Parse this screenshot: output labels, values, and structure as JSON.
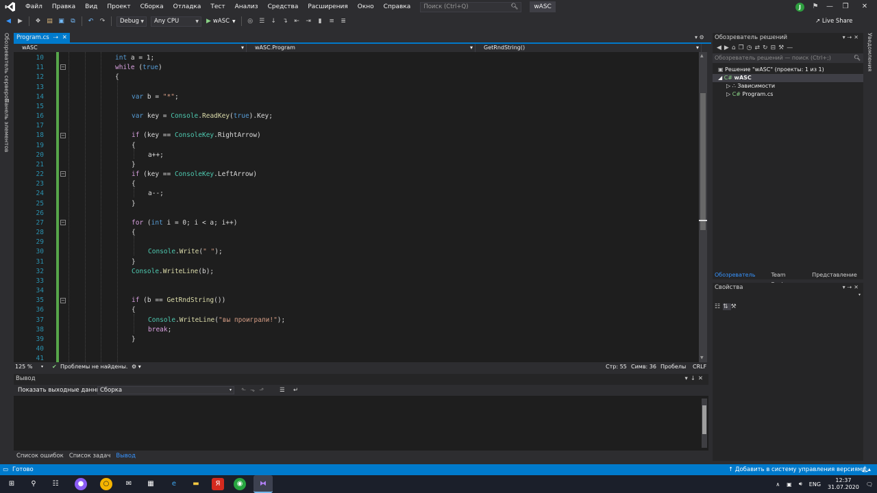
{
  "menu": {
    "items": [
      "Файл",
      "Правка",
      "Вид",
      "Проект",
      "Сборка",
      "Отладка",
      "Тест",
      "Анализ",
      "Средства",
      "Расширения",
      "Окно",
      "Справка"
    ],
    "search_placeholder": "Поиск (Ctrl+Q)",
    "project_badge": "wASC",
    "avatar_letter": "J"
  },
  "toolbar": {
    "config": "Debug",
    "platform": "Any CPU",
    "run_label": "wASC",
    "live_share": "Live Share"
  },
  "left_strip": {
    "server_explorer": "Обозреватель серверов",
    "toolbox": "Панель элементов"
  },
  "right_strip": {
    "notifications": "Уведомления"
  },
  "editor": {
    "tab_label": "Program.cs",
    "nav_project": "wASC",
    "nav_class": "wASC.Program",
    "nav_member": "GetRndString()",
    "line_numbers": [
      "10",
      "11",
      "12",
      "13",
      "14",
      "15",
      "16",
      "17",
      "18",
      "19",
      "20",
      "21",
      "22",
      "23",
      "24",
      "25",
      "26",
      "27",
      "28",
      "29",
      "30",
      "31",
      "32",
      "33",
      "34",
      "35",
      "36",
      "37",
      "38",
      "39",
      "40",
      "41"
    ],
    "code": {
      "l10": "int a = 1;",
      "l11": "while (true)",
      "l12": "{",
      "l14": "var b = \"*\";",
      "l16": "var key = Console.ReadKey(true).Key;",
      "l18": "if (key == ConsoleKey.RightArrow)",
      "l19": "{",
      "l20": "a++;",
      "l21": "}",
      "l22": "if (key == ConsoleKey.LeftArrow)",
      "l23": "{",
      "l24": "a--;",
      "l25": "}",
      "l27": "for (int i = 0; i < a; i++)",
      "l28": "{",
      "l30": "Console.Write(\" \");",
      "l31": "}",
      "l32": "Console.WriteLine(b);",
      "l35": "if (b == GetRndString())",
      "l36": "{",
      "l37": "Console.WriteLine(\"вы проиграли!\");",
      "l38": "break;",
      "l39": "}"
    },
    "zoom": "125 %",
    "problems": "Проблемы не найдены.",
    "line_pos": "Стр: 55",
    "col_pos": "Симв: 36",
    "whitespace": "Пробелы",
    "line_ending": "CRLF"
  },
  "output": {
    "title": "Вывод",
    "show_from_label": "Показать выходные данные из:",
    "source": "Сборка"
  },
  "bottom_tabs": [
    "Список ошибок",
    "Список задач",
    "Вывод"
  ],
  "solution_explorer": {
    "title": "Обозреватель решений",
    "search_placeholder": "Обозреватель решений — поиск (Ctrl+;)",
    "solution_node": "Решение \"wASC\" (проекты: 1 из 1)",
    "project_node": "wASC",
    "dependencies_node": "Зависимости",
    "file_node": "Program.cs",
    "tabs": [
      "Обозреватель ре...",
      "Team Explorer",
      "Представление кл..."
    ]
  },
  "properties": {
    "title": "Свойства"
  },
  "statusbar": {
    "ready": "Готово",
    "source_control": "Добавить в систему управления версиями"
  },
  "taskbar": {
    "lang": "ENG",
    "time": "12:37",
    "date": "31.07.2020"
  },
  "colors": {
    "accent": "#007acc",
    "editor_bg": "#1e1e1e",
    "keyword": "#569cd6",
    "type": "#4ec9b0",
    "method": "#dcdcaa",
    "string": "#d69d85",
    "control": "#d8a0df"
  }
}
